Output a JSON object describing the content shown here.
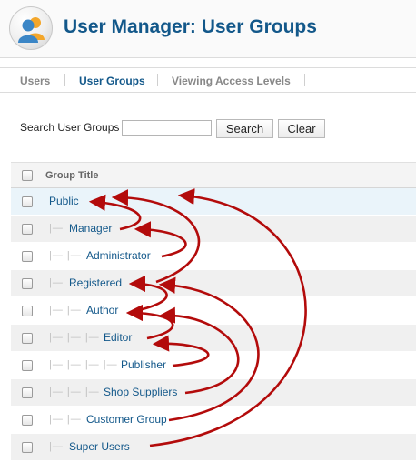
{
  "header": {
    "title": "User Manager: User Groups",
    "icon": "users-icon"
  },
  "tabs": [
    {
      "label": "Users",
      "active": false
    },
    {
      "label": "User Groups",
      "active": true
    },
    {
      "label": "Viewing Access Levels",
      "active": false
    }
  ],
  "search": {
    "label": "Search User Groups",
    "value": "",
    "placeholder": "",
    "search_label": "Search",
    "clear_label": "Clear"
  },
  "table": {
    "column_title": "Group Title",
    "rows": [
      {
        "name": "Public",
        "level": 0,
        "prefix": ""
      },
      {
        "name": "Manager",
        "level": 1,
        "prefix": "|—"
      },
      {
        "name": "Administrator",
        "level": 2,
        "prefix": "|— |—"
      },
      {
        "name": "Registered",
        "level": 1,
        "prefix": "|—"
      },
      {
        "name": "Author",
        "level": 2,
        "prefix": "|— |—"
      },
      {
        "name": "Editor",
        "level": 3,
        "prefix": "|— |— |—"
      },
      {
        "name": "Publisher",
        "level": 4,
        "prefix": "|— |— |— |—"
      },
      {
        "name": "Shop Suppliers",
        "level": 3,
        "prefix": "|— |— |—"
      },
      {
        "name": "Customer Group",
        "level": 2,
        "prefix": "|— |—"
      },
      {
        "name": "Super Users",
        "level": 1,
        "prefix": "|—"
      }
    ]
  },
  "colors": {
    "accent": "#13588a",
    "arrow": "#b30b0b"
  }
}
